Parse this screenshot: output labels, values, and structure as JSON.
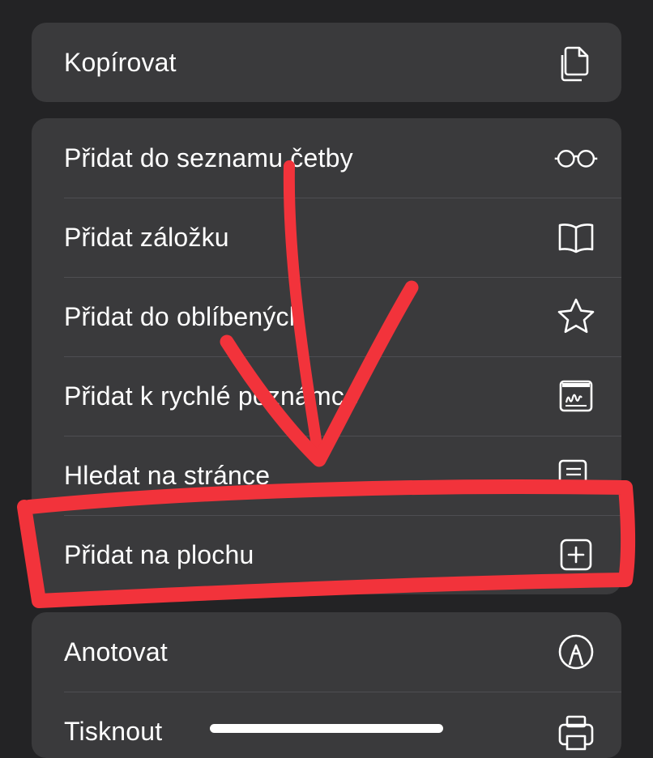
{
  "menu": {
    "group1": [
      {
        "label": "Kopírovat",
        "icon": "copy-icon"
      }
    ],
    "group2": [
      {
        "label": "Přidat do seznamu četby",
        "icon": "glasses-icon"
      },
      {
        "label": "Přidat záložku",
        "icon": "book-icon"
      },
      {
        "label": "Přidat do oblíbených",
        "icon": "star-icon"
      },
      {
        "label": "Přidat k rychlé poznámce",
        "icon": "quick-note-icon"
      },
      {
        "label": "Hledat na stránce",
        "icon": "find-in-page-icon"
      },
      {
        "label": "Přidat na plochu",
        "icon": "add-square-icon"
      }
    ],
    "group3": [
      {
        "label": "Anotovat",
        "icon": "markup-icon"
      },
      {
        "label": "Tisknout",
        "icon": "printer-icon"
      }
    ]
  },
  "annotation": {
    "color": "#f2333b",
    "highlighted_item": "Přidat na plochu"
  },
  "colors": {
    "background": "#232325",
    "card": "#3a3a3c",
    "separator": "#4e4e52",
    "text": "#ffffff"
  }
}
